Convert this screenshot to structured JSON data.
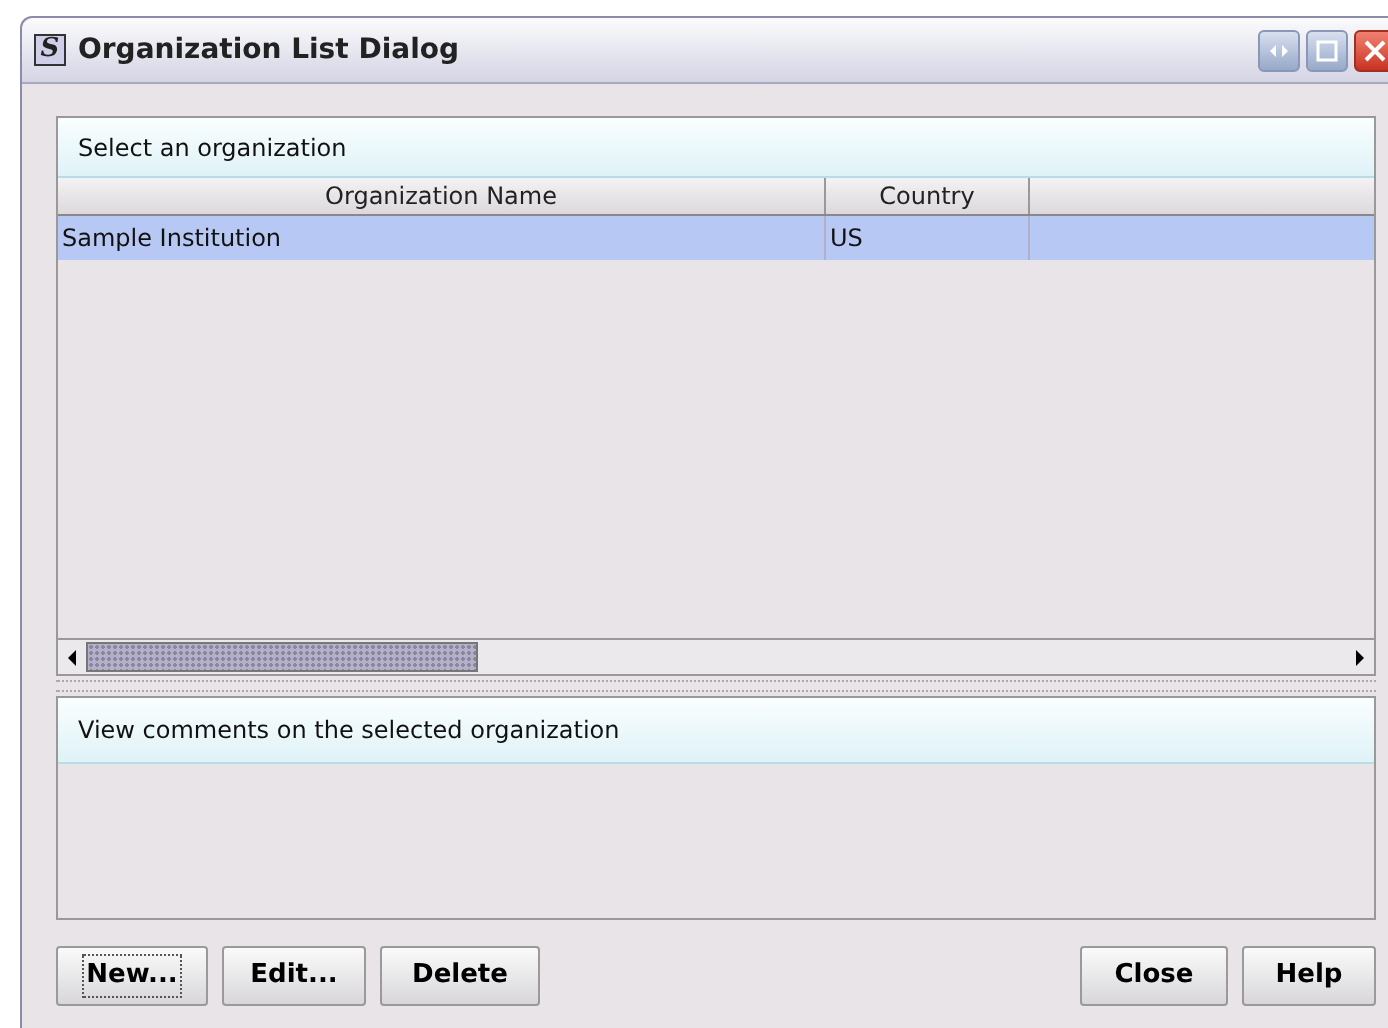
{
  "window": {
    "title": "Organization List Dialog",
    "app_icon": "S"
  },
  "list_panel": {
    "heading": "Select an organization"
  },
  "table": {
    "columns": [
      "Organization Name",
      "Country"
    ],
    "rows": [
      {
        "cells": [
          "Sample Institution",
          "US"
        ],
        "selected": true
      }
    ]
  },
  "comments_panel": {
    "heading": "View comments on the selected organization"
  },
  "buttons_left": [
    {
      "label": "New...",
      "focused": true
    },
    {
      "label": "Edit...",
      "focused": false
    },
    {
      "label": "Delete",
      "focused": false
    }
  ],
  "buttons_right": [
    {
      "label": "Close",
      "focused": false
    },
    {
      "label": "Help",
      "focused": false
    }
  ]
}
